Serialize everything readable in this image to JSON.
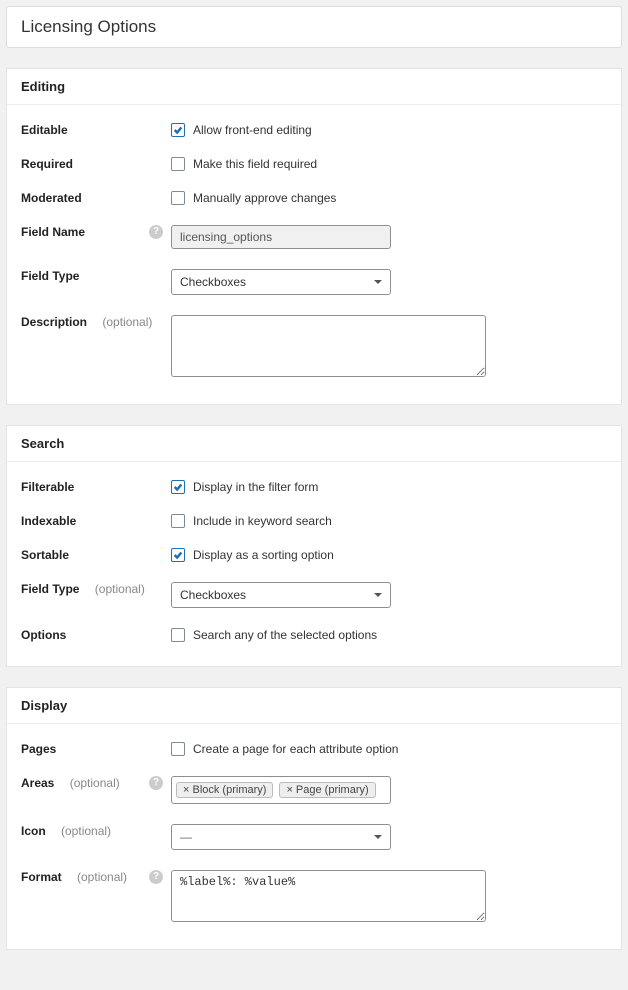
{
  "title": "Licensing Options",
  "editing": {
    "heading": "Editing",
    "editable": {
      "label": "Editable",
      "checkbox_label": "Allow front-end editing",
      "checked": true
    },
    "required": {
      "label": "Required",
      "checkbox_label": "Make this field required",
      "checked": false
    },
    "moderated": {
      "label": "Moderated",
      "checkbox_label": "Manually approve changes",
      "checked": false
    },
    "field_name": {
      "label": "Field Name",
      "value": "licensing_options"
    },
    "field_type": {
      "label": "Field Type",
      "value": "Checkboxes"
    },
    "description": {
      "label": "Description",
      "optional": "(optional)",
      "value": ""
    }
  },
  "search": {
    "heading": "Search",
    "filterable": {
      "label": "Filterable",
      "checkbox_label": "Display in the filter form",
      "checked": true
    },
    "indexable": {
      "label": "Indexable",
      "checkbox_label": "Include in keyword search",
      "checked": false
    },
    "sortable": {
      "label": "Sortable",
      "checkbox_label": "Display as a sorting option",
      "checked": true
    },
    "field_type": {
      "label": "Field Type",
      "optional": "(optional)",
      "value": "Checkboxes"
    },
    "options": {
      "label": "Options",
      "checkbox_label": "Search any of the selected options",
      "checked": false
    }
  },
  "display": {
    "heading": "Display",
    "pages": {
      "label": "Pages",
      "checkbox_label": "Create a page for each attribute option",
      "checked": false
    },
    "areas": {
      "label": "Areas",
      "optional": "(optional)",
      "tags": [
        "× Block (primary)",
        "× Page (primary)"
      ]
    },
    "icon": {
      "label": "Icon",
      "optional": "(optional)",
      "value": "—"
    },
    "format": {
      "label": "Format",
      "optional": "(optional)",
      "value": "%label%: %value%"
    }
  }
}
